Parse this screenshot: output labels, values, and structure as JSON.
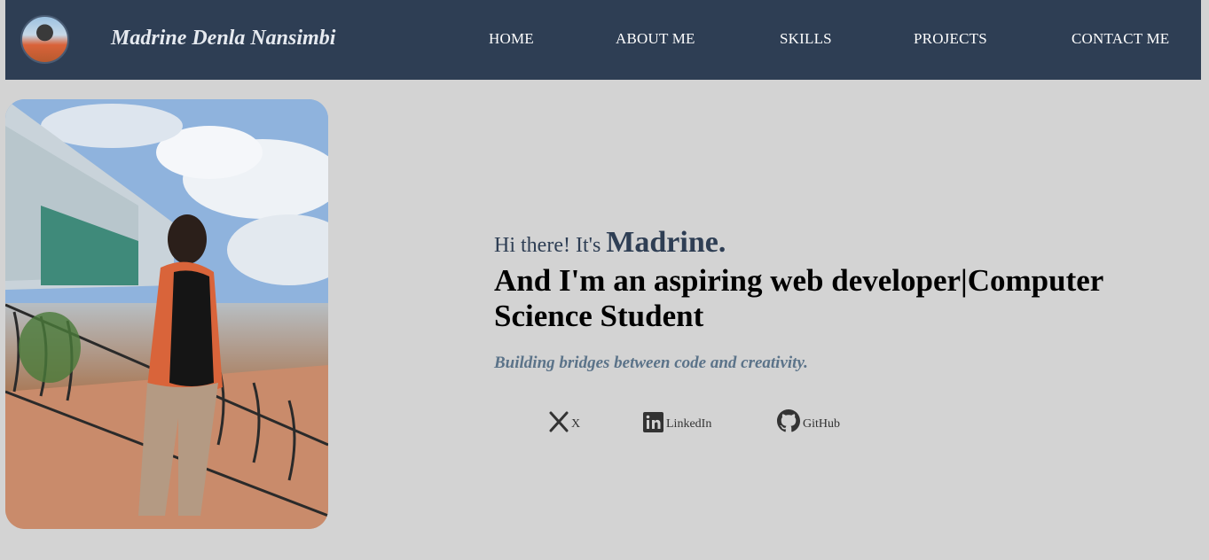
{
  "header": {
    "brand": "Madrine Denla Nansimbi",
    "avatar_icon": "profile-avatar",
    "nav": [
      {
        "label": "HOME"
      },
      {
        "label": "ABOUT ME"
      },
      {
        "label": "SKILLS"
      },
      {
        "label": "PROJECTS"
      },
      {
        "label": "CONTACT ME"
      }
    ]
  },
  "hero": {
    "greeting": "Hi there! It's",
    "name": "Madrine.",
    "headline": "And I'm an aspiring web developer|Computer Science Student",
    "tagline": "Building bridges between code and creativity."
  },
  "social": [
    {
      "icon": "x-logo-icon",
      "label": "X"
    },
    {
      "icon": "linkedin-icon",
      "label": "LinkedIn"
    },
    {
      "icon": "github-icon",
      "label": "GitHub"
    }
  ],
  "colors": {
    "navbar": "#2e3e54",
    "page_background": "#d3d3d3",
    "accent_name": "#2e3e54",
    "tagline": "#5b7389"
  }
}
